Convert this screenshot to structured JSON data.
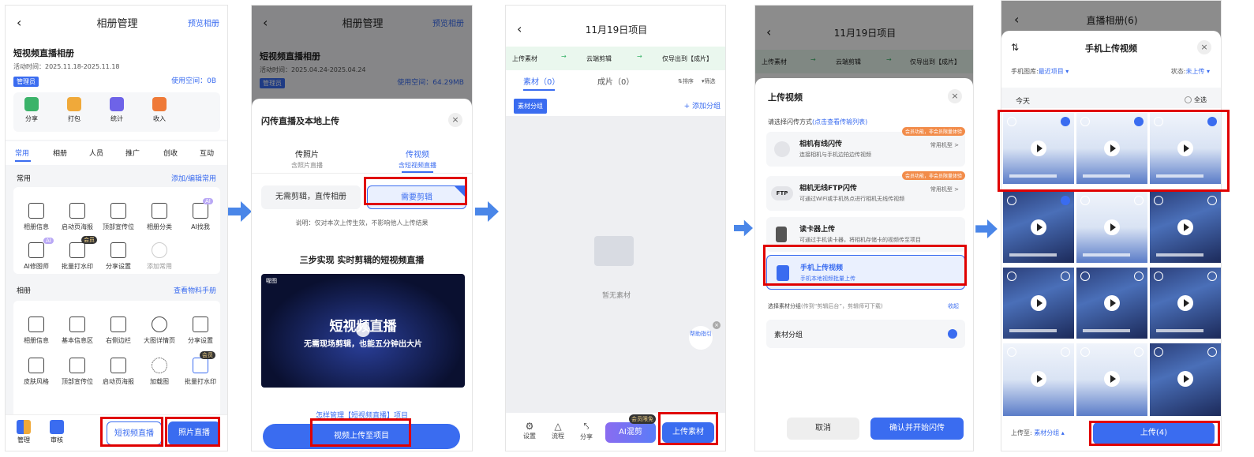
{
  "p1": {
    "title": "相册管理",
    "preview": "预览相册",
    "album_name": "短视频直播相册",
    "activity_time": "活动时间：2025.11.18-2025.11.18",
    "role": "管理员",
    "space": "使用空间：0B",
    "quick": [
      {
        "label": "分享"
      },
      {
        "label": "打包"
      },
      {
        "label": "统计"
      },
      {
        "label": "收入"
      }
    ],
    "tabs": [
      "常用",
      "相册",
      "人员",
      "推广",
      "创收",
      "互动"
    ],
    "common_title": "常用",
    "common_action": "添加/编辑常用",
    "common_items": [
      "相册信息",
      "启动页海报",
      "顶部宣传位",
      "相册分类",
      "AI找我",
      "AI修图师",
      "批量打水印",
      "分享设置",
      "添加常用"
    ],
    "album_title": "相册",
    "album_action": "查看物料手册",
    "album_items": [
      "相册信息",
      "基本信息区",
      "右侧边栏",
      "大图详情页",
      "分享设置",
      "皮肤风格",
      "顶部宣传位",
      "启动页海报",
      "加载图",
      "批量打水印"
    ],
    "ai_badge": "AI",
    "vip_badge": "会员",
    "bottom": {
      "manage": "管理",
      "review": "审核",
      "short_video": "短视频直播",
      "photo": "照片直播"
    }
  },
  "p2": {
    "title": "相册管理",
    "preview": "预览相册",
    "album_name": "短视频直播相册",
    "activity_time": "活动时间：2025.04.24-2025.04.24",
    "role": "管理员",
    "space": "使用空间：64.29MB",
    "sheet_title": "闪传直播及本地上传",
    "tab1": "传照片",
    "tab1_sub": "含照片直播",
    "tab2": "传视频",
    "tab2_sub": "含短视频直播",
    "opt1": "无需剪辑，直传相册",
    "opt2": "需要剪辑",
    "note": "说明：仅对本次上传生效，不影响他人上传结果",
    "steps": "三步实现 实时剪辑的短视频直播",
    "video_brand": "喔图",
    "video_title": "短视频直播",
    "video_sub": "无需现场剪辑，也能五分钟出大片",
    "howto": "怎样管理【短视频直播】项目",
    "upload_btn": "视频上传至项目"
  },
  "p3": {
    "title": "11月19日项目",
    "flow": [
      "上传素材",
      "云端剪辑",
      "仅导出到【成片】"
    ],
    "tab_material": "素材（0）",
    "tab_final": "成片（0）",
    "sort": "排序",
    "filter": "筛选",
    "group_tag": "素材分组",
    "add_group": "+ 添加分组",
    "empty": "暂无素材",
    "help": "帮助指引",
    "bottom": {
      "settings": "设置",
      "flow": "流程",
      "share": "分享",
      "ai": "AI混剪",
      "vip": "会员限免",
      "upload": "上传素材"
    }
  },
  "p4": {
    "title": "11月19日项目",
    "flow": [
      "上传素材",
      "云端剪辑",
      "仅导出到【成片】"
    ],
    "sheet_title": "上传视频",
    "choose": "请选择闪传方式",
    "choose_link": "(点击查看传输列表)",
    "options": [
      {
        "title": "相机有线闪传",
        "desc": "连接相机与手机边拍边传视频",
        "right": "常用机型 >",
        "badge": "会员功能，非会员限量体验"
      },
      {
        "title": "相机无线FTP闪传",
        "desc": "可通过WiFi或手机热点进行相机无线传视频",
        "right": "常用机型 >",
        "badge": "会员功能，非会员限量体验"
      },
      {
        "title": "读卡器上传",
        "desc": "可通过手机读卡器，将相机存储卡的视频传至项目",
        "right": "",
        "badge": ""
      },
      {
        "title": "手机上传视频",
        "desc": "手机本地视频批量上传",
        "right": "",
        "badge": ""
      }
    ],
    "ftp_label": "FTP",
    "group_label": "选择素材分组",
    "group_hint": "(传到“剪辑后台”，剪辑师可下载)",
    "collapse": "收起",
    "group_item": "素材分组",
    "cancel": "取消",
    "confirm": "确认并开始闪传"
  },
  "p5": {
    "bg_title": "直播相册(6)",
    "sheet_title": "手机上传视频",
    "gallery": "手机图库:",
    "gallery_val": "最近项目",
    "status": "状态:",
    "status_val": "未上传",
    "today": "今天",
    "select_all": "全选",
    "upload_to": "上传至:",
    "upload_to_val": "素材分组",
    "upload_btn": "上传(4)"
  },
  "colors": {
    "accent": "#3a6cf0",
    "red": "#e00000",
    "arrow": "#4a86e8"
  }
}
